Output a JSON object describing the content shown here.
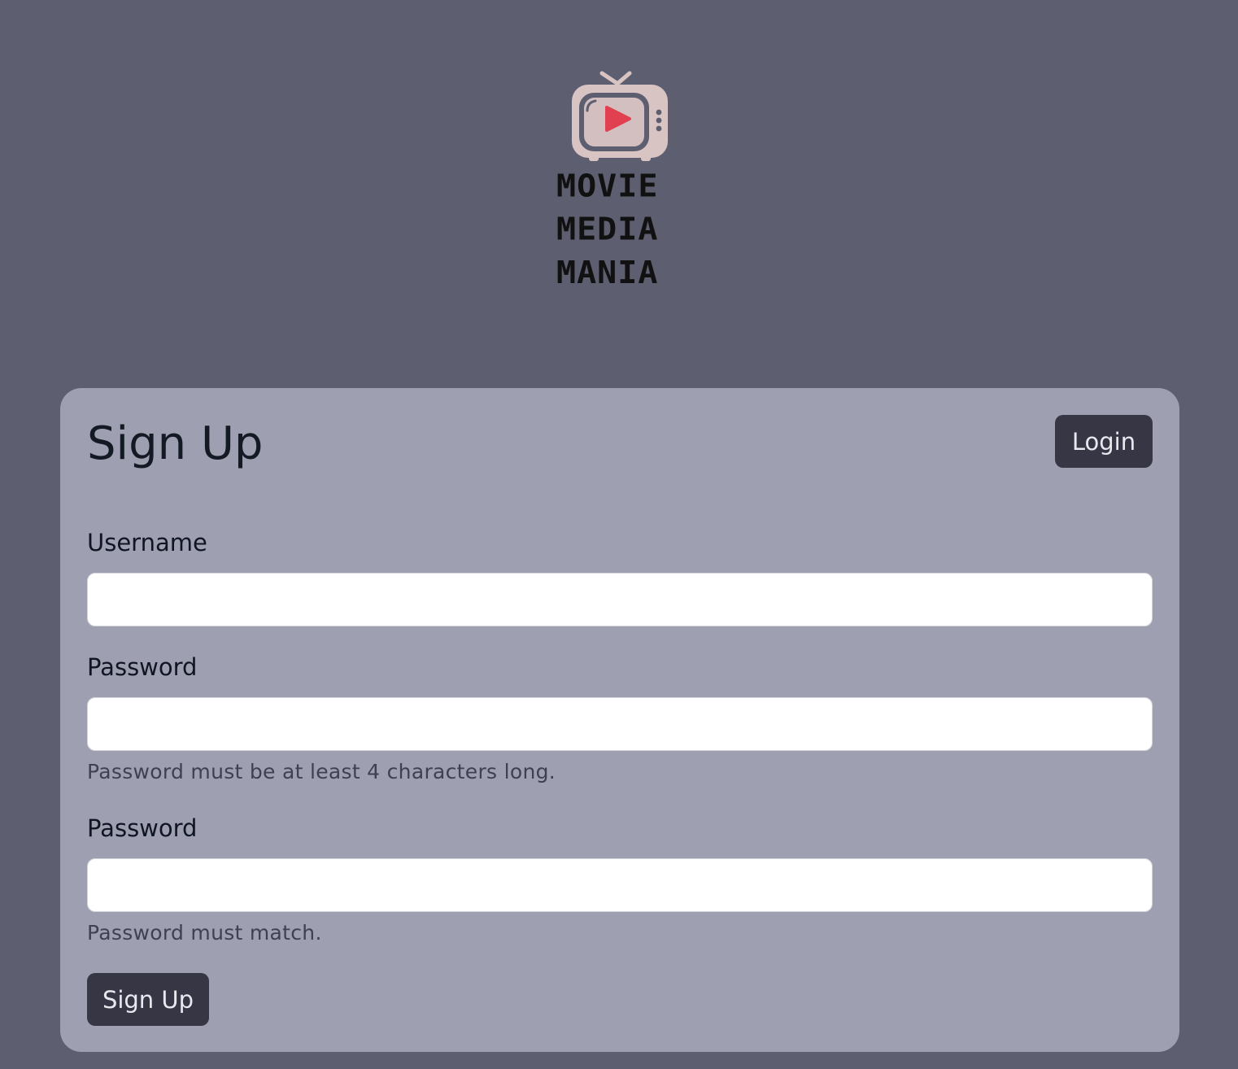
{
  "logo": {
    "icon": "tv-play-icon",
    "lines": [
      "MOVIE",
      "MEDIA",
      "MANIA"
    ],
    "colors": {
      "tv_body": "#d9c4c4",
      "play": "#e0404f",
      "text": "#111111"
    }
  },
  "signup_card": {
    "title": "Sign Up",
    "login_button": "Login",
    "fields": [
      {
        "label": "Username",
        "value": "",
        "placeholder": "",
        "hint": ""
      },
      {
        "label": "Password",
        "value": "",
        "placeholder": "",
        "hint": "Password must be at least 4 characters long."
      },
      {
        "label": "Password",
        "value": "",
        "placeholder": "",
        "hint": "Password must match."
      }
    ],
    "submit_button": "Sign Up"
  },
  "colors": {
    "page_background": "#5d5e70",
    "card_background": "#9e9fb1",
    "button_background": "#363645",
    "button_text": "#e8e8ee"
  }
}
